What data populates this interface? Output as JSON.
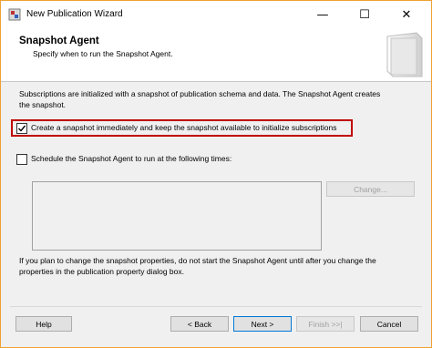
{
  "window": {
    "title": "New Publication Wizard"
  },
  "titlebar": {
    "minimize": "—",
    "maximize": "☐",
    "close": "✕"
  },
  "header": {
    "title": "Snapshot Agent",
    "subtitle": "Specify when to run the Snapshot Agent."
  },
  "body": {
    "intro_line1": "Subscriptions are initialized with a snapshot of publication schema and data. The Snapshot Agent creates",
    "intro_line2": "the snapshot.",
    "option_immediate": {
      "label": "Create a snapshot immediately and keep the snapshot available to initialize subscriptions",
      "checked": true
    },
    "option_schedule": {
      "label": "Schedule the Snapshot Agent to run at the following times:",
      "checked": false
    },
    "change_button": "Change...",
    "note_line1": "If you plan to change the snapshot properties, do not start the Snapshot Agent until after you change the",
    "note_line2": "properties in the publication property dialog box."
  },
  "footer": {
    "help": "Help",
    "back": "< Back",
    "next": "Next >",
    "finish": "Finish >>|",
    "cancel": "Cancel"
  },
  "colors": {
    "highlight": "#c00000",
    "window_border": "#f0a030",
    "accent": "#0078d7"
  },
  "icons": [
    "app-icon",
    "minimize-icon",
    "maximize-icon",
    "close-icon",
    "checkmark-icon",
    "header-graphic"
  ]
}
